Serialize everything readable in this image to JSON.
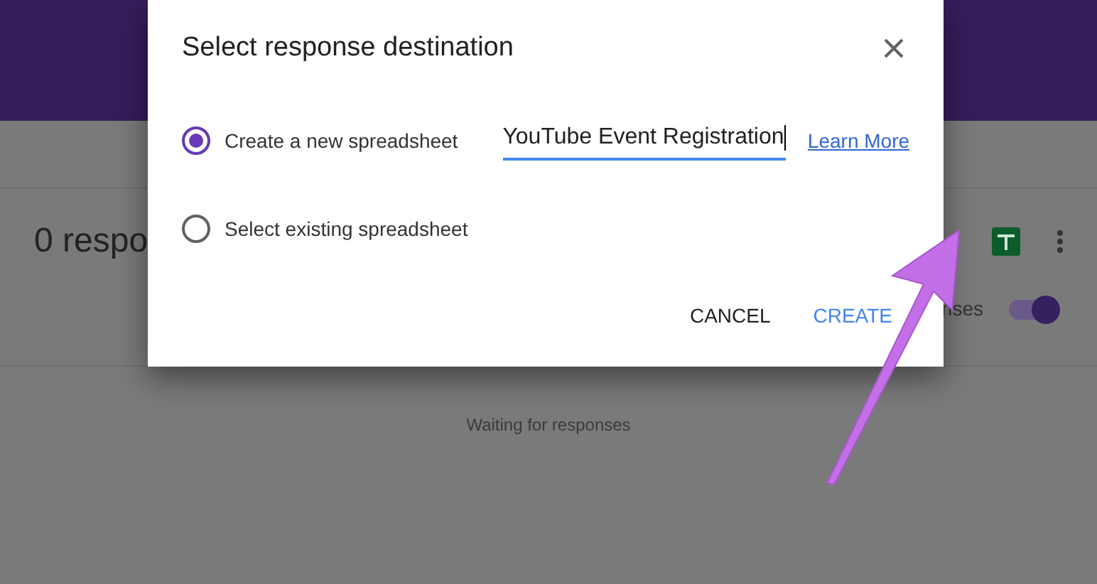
{
  "page": {
    "responses_title": "0 respo",
    "accepting_label": "nses",
    "accepting": {
      "on": true
    },
    "empty_message": "Waiting for responses"
  },
  "dialog": {
    "title": "Select response destination",
    "options": [
      {
        "label": "Create a new spreadsheet",
        "selected": true,
        "value": "YouTube Event Registration",
        "link": "Learn More"
      },
      {
        "label": "Select existing spreadsheet",
        "selected": false
      }
    ],
    "buttons": [
      {
        "label": "CANCEL",
        "kind": "text"
      },
      {
        "label": "CREATE",
        "kind": "primary"
      }
    ]
  }
}
